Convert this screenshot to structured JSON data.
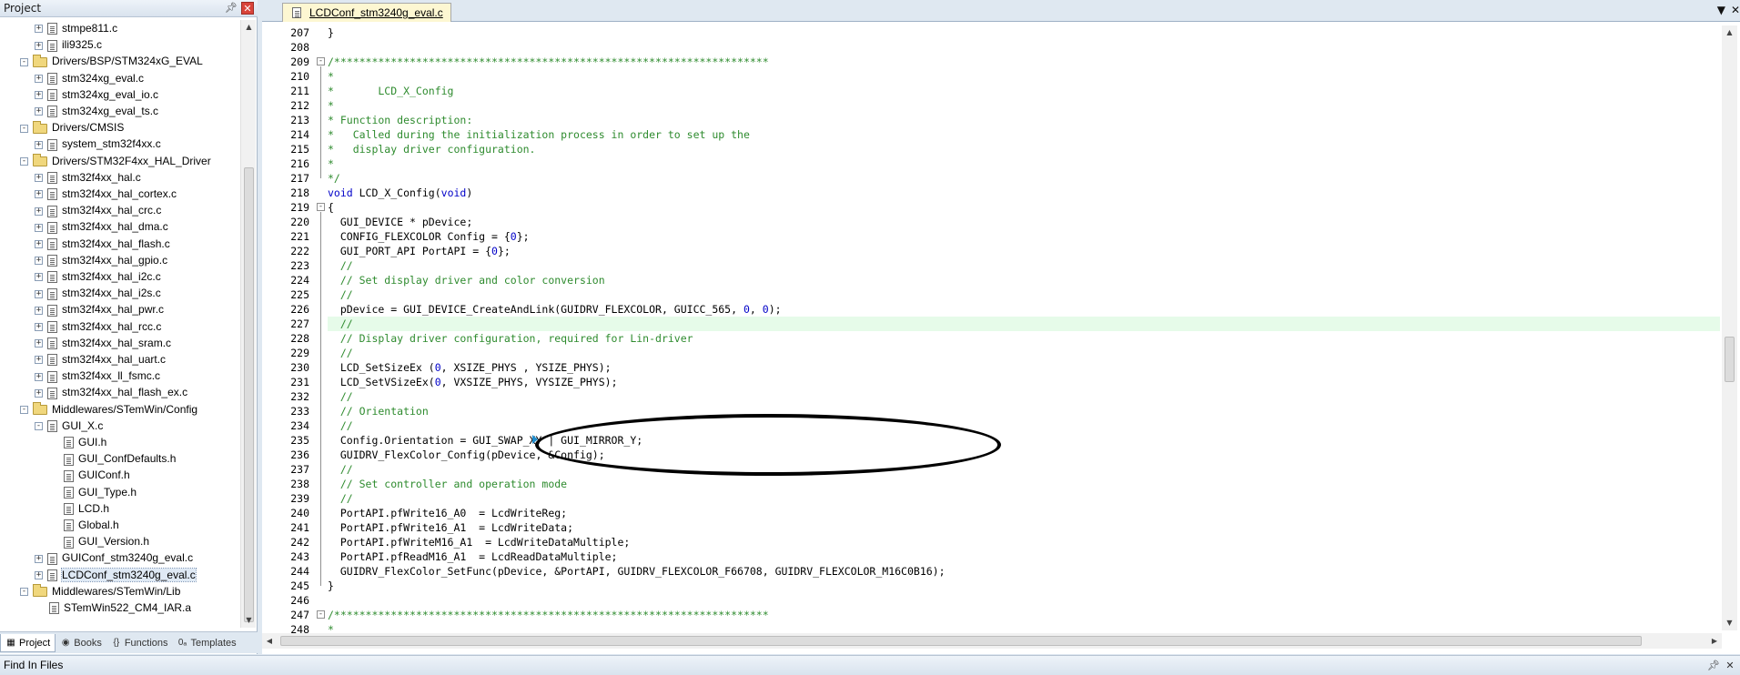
{
  "project_pane": {
    "title": "Project",
    "tree": [
      {
        "label": "stmpe811.c",
        "kind": "file",
        "depth": 2,
        "expander": "+"
      },
      {
        "label": "ili9325.c",
        "kind": "file",
        "depth": 2,
        "expander": "+"
      },
      {
        "label": "Drivers/BSP/STM324xG_EVAL",
        "kind": "folder",
        "depth": 1,
        "expander": "-"
      },
      {
        "label": "stm324xg_eval.c",
        "kind": "file",
        "depth": 2,
        "expander": "+"
      },
      {
        "label": "stm324xg_eval_io.c",
        "kind": "file",
        "depth": 2,
        "expander": "+"
      },
      {
        "label": "stm324xg_eval_ts.c",
        "kind": "file",
        "depth": 2,
        "expander": "+"
      },
      {
        "label": "Drivers/CMSIS",
        "kind": "folder",
        "depth": 1,
        "expander": "-"
      },
      {
        "label": "system_stm32f4xx.c",
        "kind": "file",
        "depth": 2,
        "expander": "+"
      },
      {
        "label": "Drivers/STM32F4xx_HAL_Driver",
        "kind": "folder",
        "depth": 1,
        "expander": "-"
      },
      {
        "label": "stm32f4xx_hal.c",
        "kind": "file",
        "depth": 2,
        "expander": "+"
      },
      {
        "label": "stm32f4xx_hal_cortex.c",
        "kind": "file",
        "depth": 2,
        "expander": "+"
      },
      {
        "label": "stm32f4xx_hal_crc.c",
        "kind": "file",
        "depth": 2,
        "expander": "+"
      },
      {
        "label": "stm32f4xx_hal_dma.c",
        "kind": "file",
        "depth": 2,
        "expander": "+"
      },
      {
        "label": "stm32f4xx_hal_flash.c",
        "kind": "file",
        "depth": 2,
        "expander": "+"
      },
      {
        "label": "stm32f4xx_hal_gpio.c",
        "kind": "file",
        "depth": 2,
        "expander": "+"
      },
      {
        "label": "stm32f4xx_hal_i2c.c",
        "kind": "file",
        "depth": 2,
        "expander": "+"
      },
      {
        "label": "stm32f4xx_hal_i2s.c",
        "kind": "file",
        "depth": 2,
        "expander": "+"
      },
      {
        "label": "stm32f4xx_hal_pwr.c",
        "kind": "file",
        "depth": 2,
        "expander": "+"
      },
      {
        "label": "stm32f4xx_hal_rcc.c",
        "kind": "file",
        "depth": 2,
        "expander": "+"
      },
      {
        "label": "stm32f4xx_hal_sram.c",
        "kind": "file",
        "depth": 2,
        "expander": "+"
      },
      {
        "label": "stm32f4xx_hal_uart.c",
        "kind": "file",
        "depth": 2,
        "expander": "+"
      },
      {
        "label": "stm32f4xx_ll_fsmc.c",
        "kind": "file",
        "depth": 2,
        "expander": "+"
      },
      {
        "label": "stm32f4xx_hal_flash_ex.c",
        "kind": "file",
        "depth": 2,
        "expander": "+"
      },
      {
        "label": "Middlewares/STemWin/Config",
        "kind": "folder",
        "depth": 1,
        "expander": "-"
      },
      {
        "label": "GUI_X.c",
        "kind": "file",
        "depth": 2,
        "expander": "-"
      },
      {
        "label": "GUI.h",
        "kind": "file",
        "depth": 3,
        "expander": ""
      },
      {
        "label": "GUI_ConfDefaults.h",
        "kind": "file",
        "depth": 3,
        "expander": ""
      },
      {
        "label": "GUIConf.h",
        "kind": "file",
        "depth": 3,
        "expander": ""
      },
      {
        "label": "GUI_Type.h",
        "kind": "file",
        "depth": 3,
        "expander": ""
      },
      {
        "label": "LCD.h",
        "kind": "file",
        "depth": 3,
        "expander": ""
      },
      {
        "label": "Global.h",
        "kind": "file",
        "depth": 3,
        "expander": ""
      },
      {
        "label": "GUI_Version.h",
        "kind": "file",
        "depth": 3,
        "expander": ""
      },
      {
        "label": "GUIConf_stm3240g_eval.c",
        "kind": "file",
        "depth": 2,
        "expander": "+"
      },
      {
        "label": "LCDConf_stm3240g_eval.c",
        "kind": "file",
        "depth": 2,
        "expander": "+",
        "selected": true
      },
      {
        "label": "Middlewares/STemWin/Lib",
        "kind": "folder",
        "depth": 1,
        "expander": "-"
      },
      {
        "label": "STemWin522_CM4_IAR.a",
        "kind": "file",
        "depth": 2,
        "expander": ""
      }
    ],
    "tabs": [
      {
        "label": "Project",
        "icon": "project-icon",
        "glyph": "▦",
        "active": true
      },
      {
        "label": "Books",
        "icon": "books-icon",
        "glyph": "◉",
        "active": false
      },
      {
        "label": "Functions",
        "icon": "functions-icon",
        "glyph": "{}",
        "active": false
      },
      {
        "label": "Templates",
        "icon": "templates-icon",
        "glyph": "0ₐ",
        "active": false
      }
    ]
  },
  "editor": {
    "active_tab": "LCDConf_stm3240g_eval.c",
    "controls": [
      "▼",
      "✕"
    ],
    "lines": [
      {
        "n": "207",
        "fold": "",
        "segs": [
          [
            "p",
            "}"
          ]
        ]
      },
      {
        "n": "208",
        "fold": "",
        "segs": []
      },
      {
        "n": "209",
        "fold": "-",
        "segs": [
          [
            "cm",
            "/*********************************************************************"
          ]
        ]
      },
      {
        "n": "210",
        "fold": "",
        "segs": [
          [
            "cm",
            "*"
          ]
        ]
      },
      {
        "n": "211",
        "fold": "",
        "segs": [
          [
            "cm",
            "*       LCD_X_Config"
          ]
        ]
      },
      {
        "n": "212",
        "fold": "",
        "segs": [
          [
            "cm",
            "*"
          ]
        ]
      },
      {
        "n": "213",
        "fold": "",
        "segs": [
          [
            "cm",
            "* Function description:"
          ]
        ]
      },
      {
        "n": "214",
        "fold": "",
        "segs": [
          [
            "cm",
            "*   Called during the initialization process in order to set up the"
          ]
        ]
      },
      {
        "n": "215",
        "fold": "",
        "segs": [
          [
            "cm",
            "*   display driver configuration."
          ]
        ]
      },
      {
        "n": "216",
        "fold": "",
        "segs": [
          [
            "cm",
            "*"
          ]
        ]
      },
      {
        "n": "217",
        "fold": "",
        "segs": [
          [
            "cm",
            "*/"
          ]
        ]
      },
      {
        "n": "218",
        "fold": "",
        "segs": [
          [
            "kw",
            "void"
          ],
          [
            "p",
            " LCD_X_Config("
          ],
          [
            "kw",
            "void"
          ],
          [
            "p",
            ")"
          ]
        ]
      },
      {
        "n": "219",
        "fold": "-",
        "segs": [
          [
            "p",
            "{"
          ]
        ]
      },
      {
        "n": "220",
        "fold": "",
        "segs": [
          [
            "p",
            "  GUI_DEVICE * pDevice;"
          ]
        ]
      },
      {
        "n": "221",
        "fold": "",
        "segs": [
          [
            "p",
            "  CONFIG_FLEXCOLOR Config = {"
          ],
          [
            "num",
            "0"
          ],
          [
            "p",
            "};"
          ]
        ]
      },
      {
        "n": "222",
        "fold": "",
        "segs": [
          [
            "p",
            "  GUI_PORT_API PortAPI = {"
          ],
          [
            "num",
            "0"
          ],
          [
            "p",
            "};"
          ]
        ]
      },
      {
        "n": "223",
        "fold": "",
        "segs": [
          [
            "cm",
            "  //"
          ]
        ]
      },
      {
        "n": "224",
        "fold": "",
        "segs": [
          [
            "cm",
            "  // Set display driver and color conversion"
          ]
        ]
      },
      {
        "n": "225",
        "fold": "",
        "segs": [
          [
            "cm",
            "  //"
          ]
        ]
      },
      {
        "n": "226",
        "fold": "",
        "segs": [
          [
            "p",
            "  pDevice = GUI_DEVICE_CreateAndLink(GUIDRV_FLEXCOLOR, GUICC_565, "
          ],
          [
            "num",
            "0"
          ],
          [
            "p",
            ", "
          ],
          [
            "num",
            "0"
          ],
          [
            "p",
            ");"
          ]
        ]
      },
      {
        "n": "227",
        "fold": "",
        "hl": true,
        "segs": [
          [
            "cm",
            "  //"
          ]
        ]
      },
      {
        "n": "228",
        "fold": "",
        "segs": [
          [
            "cm",
            "  // Display driver configuration, required for Lin-driver"
          ]
        ]
      },
      {
        "n": "229",
        "fold": "",
        "segs": [
          [
            "cm",
            "  //"
          ]
        ]
      },
      {
        "n": "230",
        "fold": "",
        "segs": [
          [
            "p",
            "  LCD_SetSizeEx ("
          ],
          [
            "num",
            "0"
          ],
          [
            "p",
            ", XSIZE_PHYS , YSIZE_PHYS);"
          ]
        ]
      },
      {
        "n": "231",
        "fold": "",
        "segs": [
          [
            "p",
            "  LCD_SetVSizeEx("
          ],
          [
            "num",
            "0"
          ],
          [
            "p",
            ", VXSIZE_PHYS, VYSIZE_PHYS);"
          ]
        ]
      },
      {
        "n": "232",
        "fold": "",
        "segs": [
          [
            "cm",
            "  //"
          ]
        ]
      },
      {
        "n": "233",
        "fold": "",
        "segs": [
          [
            "cm",
            "  // Orientation"
          ]
        ]
      },
      {
        "n": "234",
        "fold": "",
        "segs": [
          [
            "cm",
            "  //"
          ]
        ]
      },
      {
        "n": "235",
        "fold": "",
        "segs": [
          [
            "p",
            "  Config.Orientation = GUI_SWAP_XY | GUI_MIRROR_Y;"
          ]
        ]
      },
      {
        "n": "236",
        "fold": "",
        "segs": [
          [
            "p",
            "  GUIDRV_FlexColor_Config(pDevice, &Config);"
          ]
        ]
      },
      {
        "n": "237",
        "fold": "",
        "segs": [
          [
            "cm",
            "  //"
          ]
        ]
      },
      {
        "n": "238",
        "fold": "",
        "segs": [
          [
            "cm",
            "  // Set controller and operation mode"
          ]
        ]
      },
      {
        "n": "239",
        "fold": "",
        "segs": [
          [
            "cm",
            "  //"
          ]
        ]
      },
      {
        "n": "240",
        "fold": "",
        "segs": [
          [
            "p",
            "  PortAPI.pfWrite16_A0  = LcdWriteReg;"
          ]
        ]
      },
      {
        "n": "241",
        "fold": "",
        "segs": [
          [
            "p",
            "  PortAPI.pfWrite16_A1  = LcdWriteData;"
          ]
        ]
      },
      {
        "n": "242",
        "fold": "",
        "segs": [
          [
            "p",
            "  PortAPI.pfWriteM16_A1  = LcdWriteDataMultiple;"
          ]
        ]
      },
      {
        "n": "243",
        "fold": "",
        "segs": [
          [
            "p",
            "  PortAPI.pfReadM16_A1  = LcdReadDataMultiple;"
          ]
        ]
      },
      {
        "n": "244",
        "fold": "",
        "segs": [
          [
            "p",
            "  GUIDRV_FlexColor_SetFunc(pDevice, &PortAPI, GUIDRV_FLEXCOLOR_F66708, GUIDRV_FLEXCOLOR_M16C0B16);"
          ]
        ]
      },
      {
        "n": "245",
        "fold": "",
        "segs": [
          [
            "p",
            "}"
          ]
        ]
      },
      {
        "n": "246",
        "fold": "",
        "segs": []
      },
      {
        "n": "247",
        "fold": "-",
        "segs": [
          [
            "cm",
            "/*********************************************************************"
          ]
        ]
      },
      {
        "n": "248",
        "fold": "",
        "segs": [
          [
            "cm",
            "*"
          ]
        ]
      }
    ]
  },
  "bottom_panel": {
    "title": "Find In Files"
  },
  "colors": {
    "comment": "#2e8b2e",
    "keyword": "#0000c8",
    "highlight_line": "#e6fbe9",
    "selection": "#dfe9f5",
    "tab_active": "#fdf7d2"
  }
}
